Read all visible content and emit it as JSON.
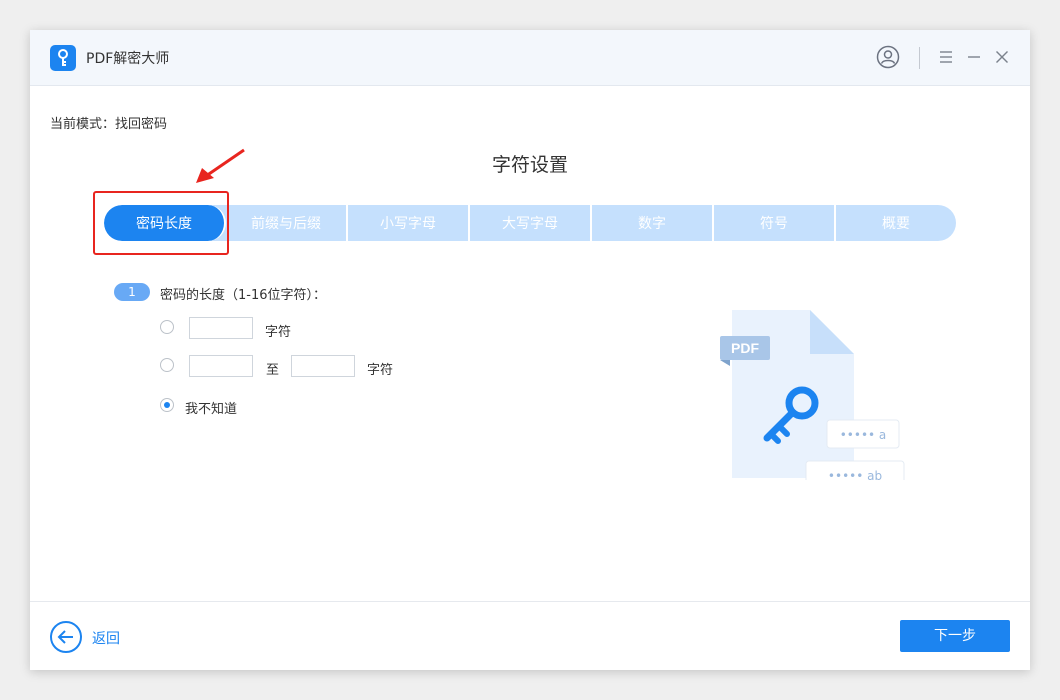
{
  "app": {
    "title": "PDF解密大师"
  },
  "mode": {
    "label": "当前模式：找回密码"
  },
  "page": {
    "title": "字符设置"
  },
  "tabs": [
    {
      "label": "密码长度",
      "active": true
    },
    {
      "label": "前缀与后缀",
      "active": false
    },
    {
      "label": "小写字母",
      "active": false
    },
    {
      "label": "大写字母",
      "active": false
    },
    {
      "label": "数字",
      "active": false
    },
    {
      "label": "符号",
      "active": false
    },
    {
      "label": "概要",
      "active": false
    }
  ],
  "length_section": {
    "step_number": "1",
    "label": "密码的长度（1-16位字符）：",
    "option_exact": {
      "unit": "字符",
      "value": ""
    },
    "option_range": {
      "from_value": "",
      "to_label": "至",
      "to_value": "",
      "unit": "字符"
    },
    "option_unknown": {
      "label": "我不知道",
      "checked": true
    }
  },
  "illustration": {
    "badge": "PDF",
    "pwd_a": "••••• a",
    "pwd_ab": "••••• ab"
  },
  "footer": {
    "back_label": "返回",
    "next_label": "下一步"
  },
  "colors": {
    "accent": "#1c84f0",
    "tab_inactive": "#c5e0fd",
    "highlight": "#e8251f"
  }
}
